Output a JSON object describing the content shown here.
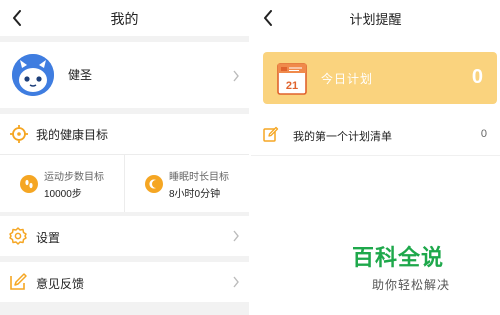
{
  "left": {
    "title": "我的",
    "profile": {
      "name": "健圣"
    },
    "health_goal": {
      "title": "我的健康目标",
      "steps": {
        "label": "运动步数目标",
        "value": "10000步"
      },
      "sleep": {
        "label": "睡眠时长目标",
        "value": "8小时0分钟"
      }
    },
    "menu": [
      {
        "label": "设置"
      },
      {
        "label": "意见反馈"
      }
    ]
  },
  "right": {
    "title": "计划提醒",
    "banner": {
      "day": "21",
      "label": "今日计划",
      "count": "0"
    },
    "plan_list": [
      {
        "label": "我的第一个计划清单",
        "count": "0"
      }
    ]
  },
  "watermark": {
    "title": "百科全说",
    "subtitle": "助你轻松解决"
  },
  "colors": {
    "accent_orange": "#f5a623",
    "banner_yellow": "#fad37e",
    "avatar_blue": "#3f7de0",
    "watermark_green": "#1ea84b"
  }
}
